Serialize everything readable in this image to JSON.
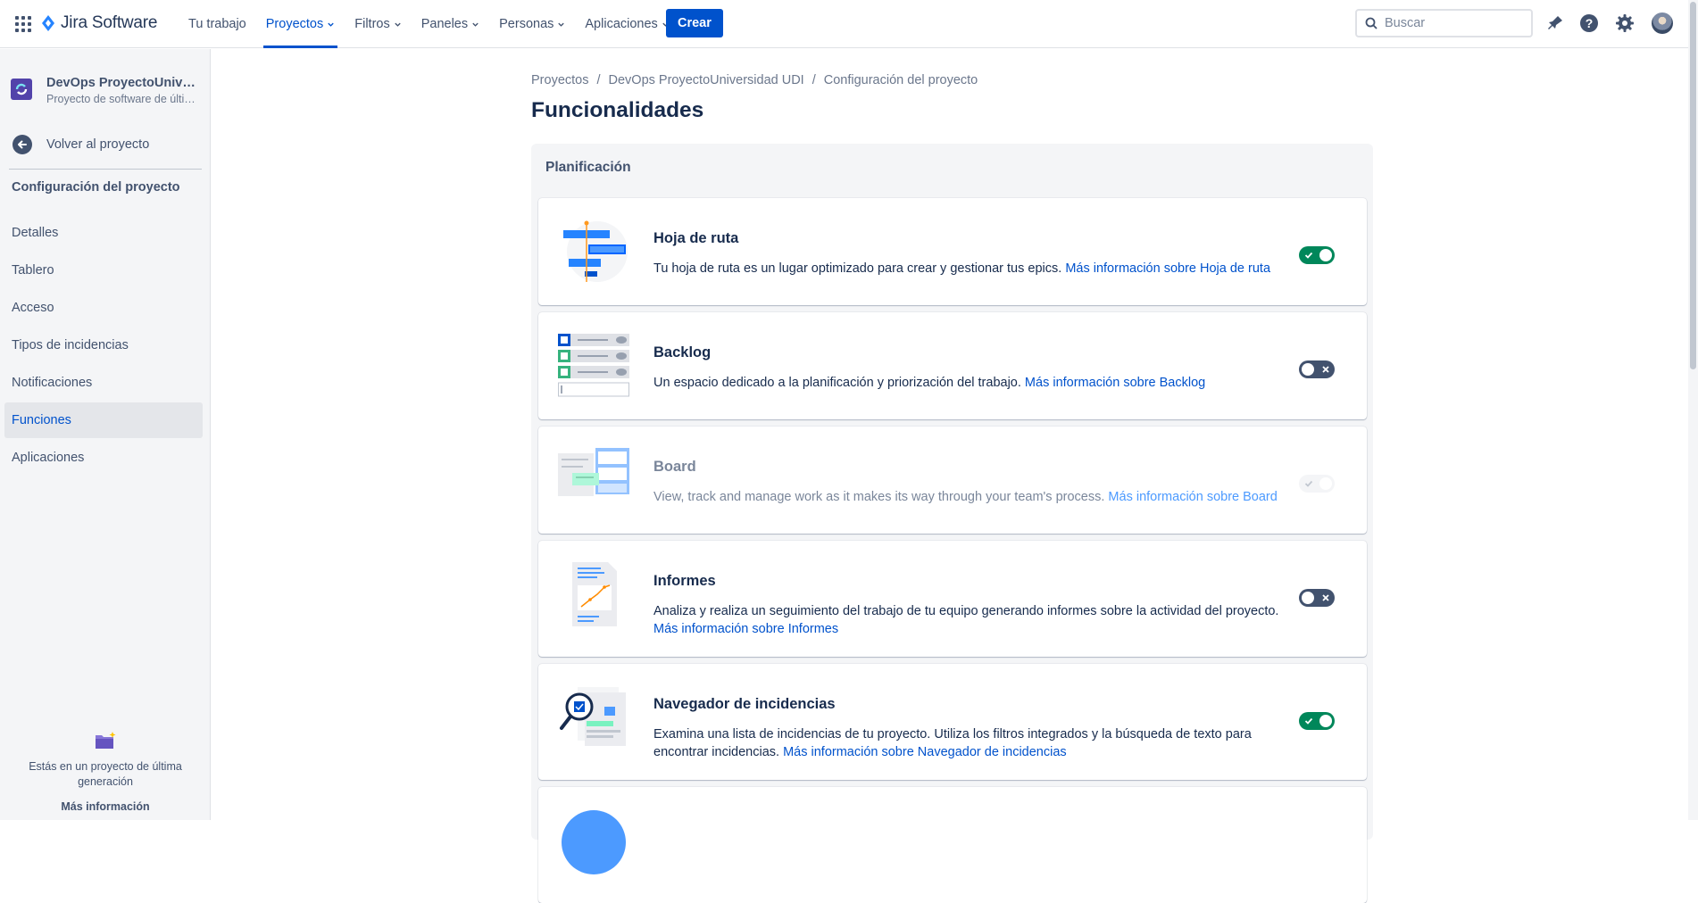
{
  "topnav": {
    "logo_text": "Jira Software",
    "items": [
      {
        "label": "Tu trabajo",
        "dropdown": false,
        "active": false
      },
      {
        "label": "Proyectos",
        "dropdown": true,
        "active": true
      },
      {
        "label": "Filtros",
        "dropdown": true,
        "active": false
      },
      {
        "label": "Paneles",
        "dropdown": true,
        "active": false
      },
      {
        "label": "Personas",
        "dropdown": true,
        "active": false
      },
      {
        "label": "Aplicaciones",
        "dropdown": true,
        "active": false
      }
    ],
    "create_label": "Crear",
    "search_placeholder": "Buscar",
    "icons": [
      "notifications-icon",
      "help-icon",
      "settings-icon"
    ]
  },
  "sidebar": {
    "project_name": "DevOps ProyectoUniversidad UDI",
    "project_type": "Proyecto de software de última generación",
    "back_label": "Volver al proyecto",
    "section_title": "Configuración del proyecto",
    "items": [
      {
        "label": "Detalles",
        "active": false
      },
      {
        "label": "Tablero",
        "active": false
      },
      {
        "label": "Acceso",
        "active": false
      },
      {
        "label": "Tipos de incidencias",
        "active": false
      },
      {
        "label": "Notificaciones",
        "active": false
      },
      {
        "label": "Funciones",
        "active": true
      },
      {
        "label": "Aplicaciones",
        "active": false
      }
    ],
    "footer_text": "Estás en un proyecto de última generación",
    "footer_link": "Más información"
  },
  "main": {
    "breadcrumbs": [
      "Proyectos",
      "DevOps ProyectoUniversidad UDI",
      "Configuración del proyecto"
    ],
    "title": "Funcionalidades",
    "section_title": "Planificación",
    "features": [
      {
        "title": "Hoja de ruta",
        "description": "Tu hoja de ruta es un lugar optimizado para crear y gestionar tus epics.",
        "link": "Más información sobre Hoja de ruta",
        "state": "on"
      },
      {
        "title": "Backlog",
        "description": "Un espacio dedicado a la planificación y priorización del trabajo.",
        "link": "Más información sobre Backlog",
        "state": "off"
      },
      {
        "title": "Board",
        "description": "View, track and manage work as it makes its way through your team's process.",
        "link": "Más información sobre Board",
        "state": "disabled"
      },
      {
        "title": "Informes",
        "description": "Analiza y realiza un seguimiento del trabajo de tu equipo generando informes sobre la actividad del proyecto.",
        "link": "Más información sobre Informes",
        "state": "off"
      },
      {
        "title": "Navegador de incidencias",
        "description": "Examina una lista de incidencias de tu proyecto. Utiliza los filtros integrados y la búsqueda de texto para encontrar incidencias.",
        "link": "Más información sobre Navegador de incidencias",
        "state": "on"
      }
    ]
  },
  "colors": {
    "brand_blue": "#0052cc",
    "toggle_on": "#00875a",
    "toggle_off": "#42526e",
    "text_primary": "#172b4d",
    "text_secondary": "#42526e"
  }
}
